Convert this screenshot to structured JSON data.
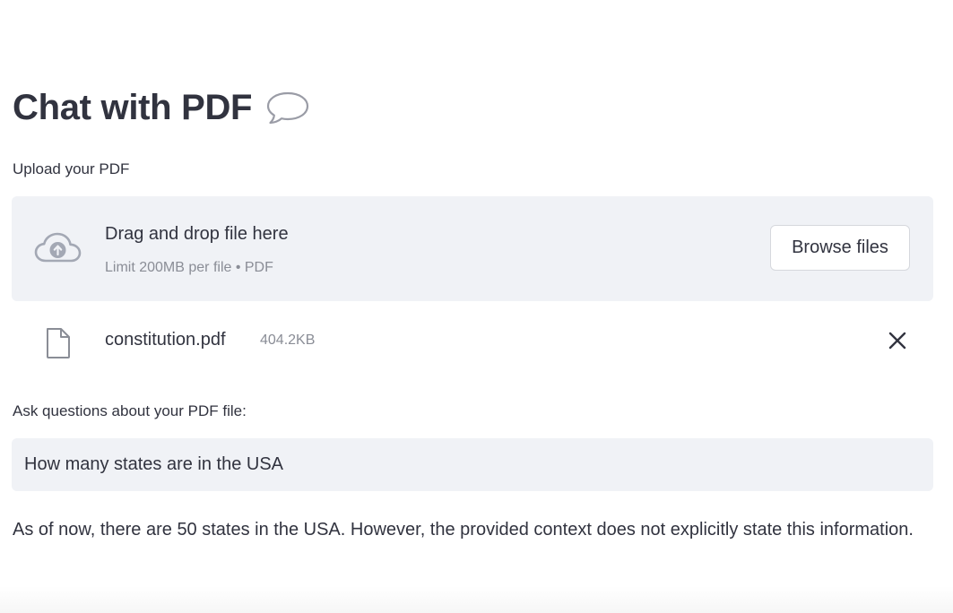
{
  "app": {
    "title": "Chat with PDF",
    "title_icon": "speech-bubble-icon"
  },
  "uploader": {
    "label": "Upload your PDF",
    "drop_text": "Drag and drop file here",
    "limit_text": "Limit 200MB per file • PDF",
    "browse_label": "Browse files",
    "icon": "cloud-upload-icon"
  },
  "file": {
    "name": "constitution.pdf",
    "size": "404.2KB",
    "icon": "file-icon",
    "remove_icon": "close-icon"
  },
  "question": {
    "label": "Ask questions about your PDF file:",
    "value": "How many states are in the USA"
  },
  "answer": {
    "text": "As of now, there are 50 states in the USA. However, the provided context does not explicitly state this information."
  },
  "colors": {
    "text": "#31333f",
    "muted": "#8a8d96",
    "panel_bg": "#f0f2f6",
    "border": "#d6d8dd"
  }
}
